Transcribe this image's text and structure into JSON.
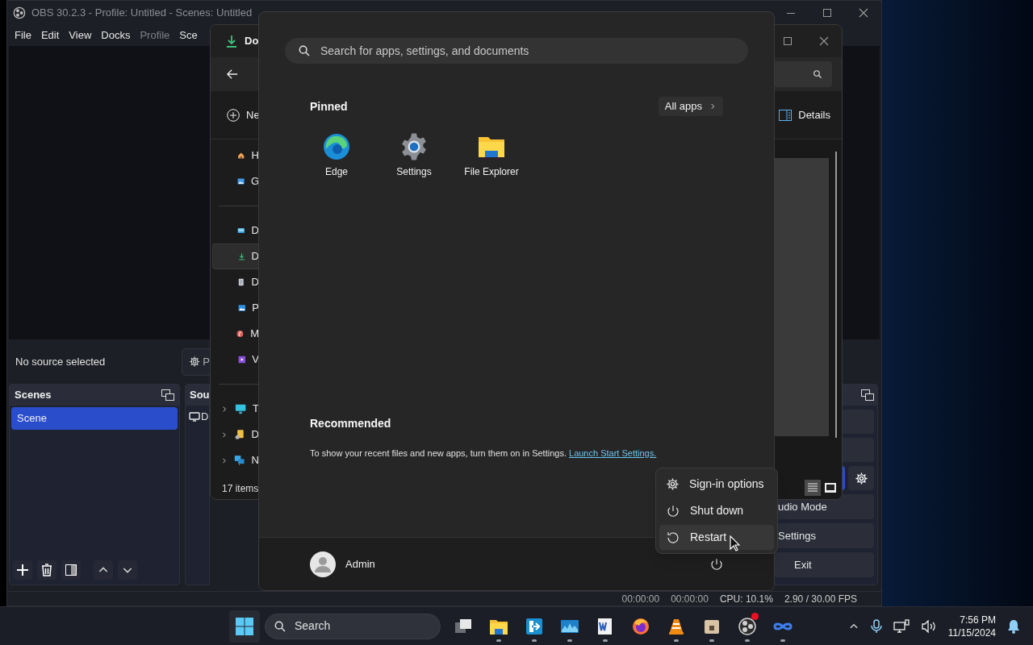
{
  "obs": {
    "title": "OBS 30.2.3 - Profile: Untitled - Scenes: Untitled",
    "menu": [
      {
        "label": "File",
        "disabled": false
      },
      {
        "label": "Edit",
        "disabled": false
      },
      {
        "label": "View",
        "disabled": false
      },
      {
        "label": "Docks",
        "disabled": false
      },
      {
        "label": "Profile",
        "disabled": true
      },
      {
        "label": "Sce",
        "disabled": false
      }
    ],
    "source_status": "No source selected",
    "properties_button": "P",
    "scenes": {
      "title": "Scenes",
      "items": [
        {
          "label": "Scene",
          "selected": true
        }
      ]
    },
    "sources": {
      "title": "Sou",
      "items": [
        {
          "label": "D"
        }
      ]
    },
    "controls": [
      {
        "label": "udio Mode"
      },
      {
        "label": "Settings"
      },
      {
        "label": "Exit"
      }
    ],
    "status": {
      "stream_time": "00:00:00",
      "record_time": "00:00:00",
      "cpu": "CPU: 10.1%",
      "fps": "2.90 / 30.00 FPS"
    }
  },
  "explorer": {
    "tab": "Do",
    "new_button": "Ne",
    "details_button": "Details",
    "nav_top": [
      {
        "label": "H",
        "kind": "home",
        "selected": false
      },
      {
        "label": "G",
        "kind": "gallery",
        "selected": false
      }
    ],
    "nav_folders": [
      {
        "label": "D",
        "kind": "desktop",
        "selected": false
      },
      {
        "label": "D",
        "kind": "downloads",
        "selected": true
      },
      {
        "label": "D",
        "kind": "documents",
        "selected": false
      },
      {
        "label": "P",
        "kind": "pictures",
        "selected": false
      },
      {
        "label": "M",
        "kind": "music",
        "selected": false
      },
      {
        "label": "V",
        "kind": "videos",
        "selected": false
      }
    ],
    "nav_tree": [
      {
        "label": "T",
        "kind": "pc",
        "selected": false
      },
      {
        "label": "D",
        "kind": "drive",
        "selected": false
      },
      {
        "label": "N",
        "kind": "network",
        "selected": false
      }
    ],
    "status": "17 items"
  },
  "start_menu": {
    "search_placeholder": "Search for apps, settings, and documents",
    "pinned": "Pinned",
    "all_apps": "All apps",
    "apps": [
      {
        "label": "Edge",
        "kind": "edge"
      },
      {
        "label": "Settings",
        "kind": "settings"
      },
      {
        "label": "File Explorer",
        "kind": "explorer"
      }
    ],
    "recommended": "Recommended",
    "recommended_text": "To show your recent files and new apps, turn them on in Settings.",
    "recommended_link": "Launch Start Settings.",
    "user": "Admin"
  },
  "power_menu": [
    {
      "label": "Sign-in options",
      "kind": "gear",
      "selected": false
    },
    {
      "label": "Shut down",
      "kind": "power",
      "selected": false
    },
    {
      "label": "Restart",
      "kind": "restart",
      "selected": true
    }
  ],
  "taskbar": {
    "search": "Search",
    "apps": [
      {
        "kind": "task-view",
        "running": false,
        "badge": false
      },
      {
        "kind": "explorer",
        "running": true,
        "badge": false
      },
      {
        "kind": "arrow-app",
        "running": true,
        "badge": false
      },
      {
        "kind": "wave-app",
        "running": true,
        "badge": false
      },
      {
        "kind": "word",
        "running": true,
        "badge": false
      },
      {
        "kind": "firefox",
        "running": false,
        "badge": false
      },
      {
        "kind": "vlc",
        "running": true,
        "badge": false
      },
      {
        "kind": "package",
        "running": true,
        "badge": false
      },
      {
        "kind": "obs",
        "running": true,
        "badge": true
      },
      {
        "kind": "infinity",
        "running": true,
        "badge": false
      }
    ],
    "time": "7:56 PM",
    "date": "11/15/2024"
  }
}
